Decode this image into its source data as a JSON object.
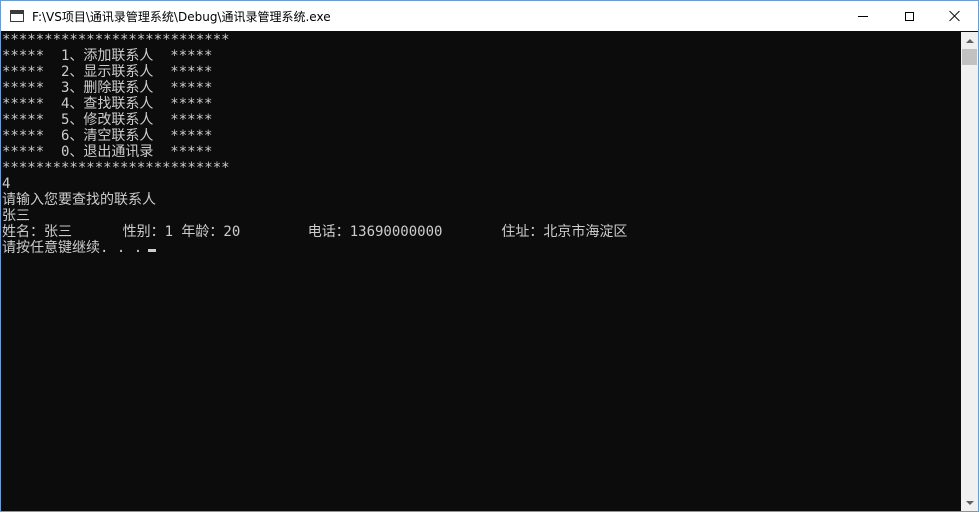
{
  "window": {
    "title": "F:\\VS项目\\通讯录管理系统\\Debug\\通讯录管理系统.exe",
    "icon": "console-app-icon",
    "controls": {
      "minimize": "minimize-icon",
      "maximize": "maximize-icon",
      "close": "close-icon"
    }
  },
  "console": {
    "text_color": "#cccccc",
    "background_color": "#0c0c0c",
    "lines": [
      "***************************",
      "*****  1、添加联系人  *****",
      "*****  2、显示联系人  *****",
      "*****  3、删除联系人  *****",
      "*****  4、查找联系人  *****",
      "*****  5、修改联系人  *****",
      "*****  6、清空联系人  *****",
      "*****  0、退出通讯录  *****",
      "***************************",
      "4",
      "请输入您要查找的联系人",
      "张三",
      "姓名：张三      性别：1 年龄：20        电话：13690000000       住址：北京市海淀区",
      "请按任意键继续. . ."
    ]
  }
}
